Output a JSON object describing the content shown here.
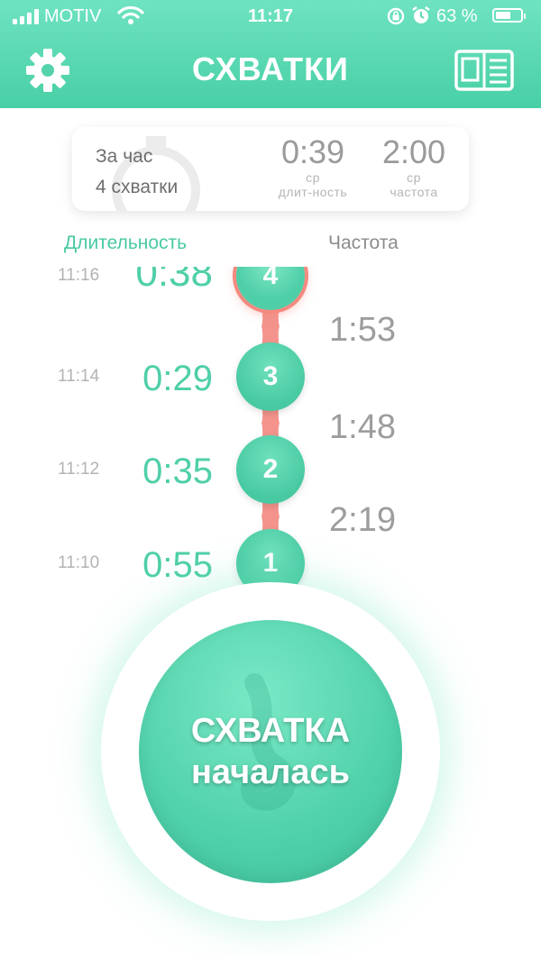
{
  "status_bar": {
    "carrier": "MOTIV",
    "time": "11:17",
    "battery_text": "63 %",
    "battery_level": 0.63,
    "icons": [
      "signal-icon",
      "wifi-icon",
      "rotation-lock-icon",
      "alarm-icon",
      "battery-icon"
    ]
  },
  "header": {
    "title": "СХВАТКИ",
    "left_icon": "gear-icon",
    "right_icon": "book-icon"
  },
  "summary": {
    "period_label": "За час",
    "count_label": "4 схватки",
    "avg_duration": {
      "value": "0:39",
      "label1": "ср",
      "label2": "длит-ность"
    },
    "avg_frequency": {
      "value": "2:00",
      "label1": "ср",
      "label2": "частота"
    }
  },
  "columns": {
    "duration": "Длительность",
    "frequency": "Частота"
  },
  "contractions": [
    {
      "number": "4",
      "time": "11:16",
      "duration": "0:38"
    },
    {
      "number": "3",
      "time": "11:14",
      "duration": "0:29"
    },
    {
      "number": "2",
      "time": "11:12",
      "duration": "0:35"
    },
    {
      "number": "1",
      "time": "11:10",
      "duration": "0:55"
    }
  ],
  "intervals": [
    "1:53",
    "1:48",
    "2:19"
  ],
  "action_button": {
    "line1": "СХВАТКА",
    "line2": "началась"
  },
  "colors": {
    "accent": "#4fcfa8",
    "header_top": "#6fe3c1",
    "header_bottom": "#48cfa6",
    "connector": "#f3938c",
    "active_bubble": "#f4897f"
  }
}
